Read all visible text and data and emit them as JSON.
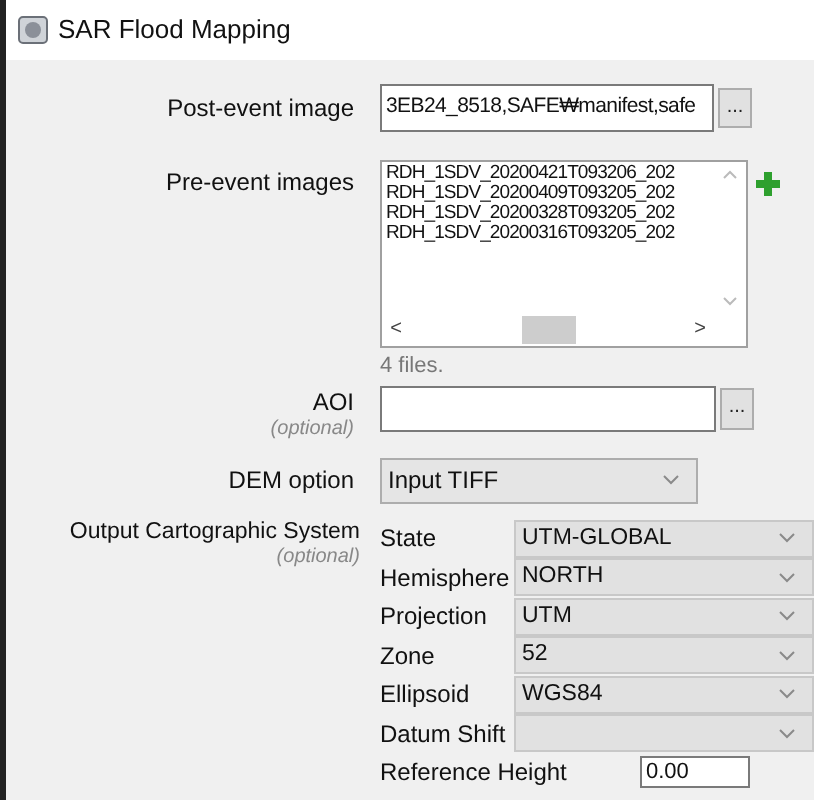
{
  "window": {
    "title": "SAR Flood Mapping"
  },
  "post_event": {
    "label": "Post-event image",
    "value": "3EB24_8518,SAFE₩manifest,safe",
    "browse": "..."
  },
  "pre_event": {
    "label": "Pre-event images",
    "files": [
      "RDH_1SDV_20200421T093206_202",
      "RDH_1SDV_20200409T093205_202",
      "RDH_1SDV_20200328T093205_202",
      "RDH_1SDV_20200316T093205_202"
    ],
    "count": "4 files.",
    "scroll_left": "<",
    "scroll_right": ">"
  },
  "aoi": {
    "label": "AOI",
    "hint": "(optional)",
    "browse": "..."
  },
  "dem": {
    "label": "DEM option",
    "value": "Input TIFF"
  },
  "output_cs": {
    "label": "Output Cartographic System",
    "hint": "(optional)",
    "rows": [
      {
        "kind": "select",
        "label": "State",
        "value": "UTM-GLOBAL"
      },
      {
        "kind": "select",
        "label": "Hemisphere",
        "value": "NORTH"
      },
      {
        "kind": "select",
        "label": "Projection",
        "value": "UTM"
      },
      {
        "kind": "select",
        "label": "Zone",
        "value": "52"
      },
      {
        "kind": "select",
        "label": "Ellipsoid",
        "value": "WGS84"
      },
      {
        "kind": "select",
        "label": "Datum Shift"
      },
      {
        "kind": "input",
        "label": "Reference Height",
        "value": "0.00"
      }
    ]
  }
}
